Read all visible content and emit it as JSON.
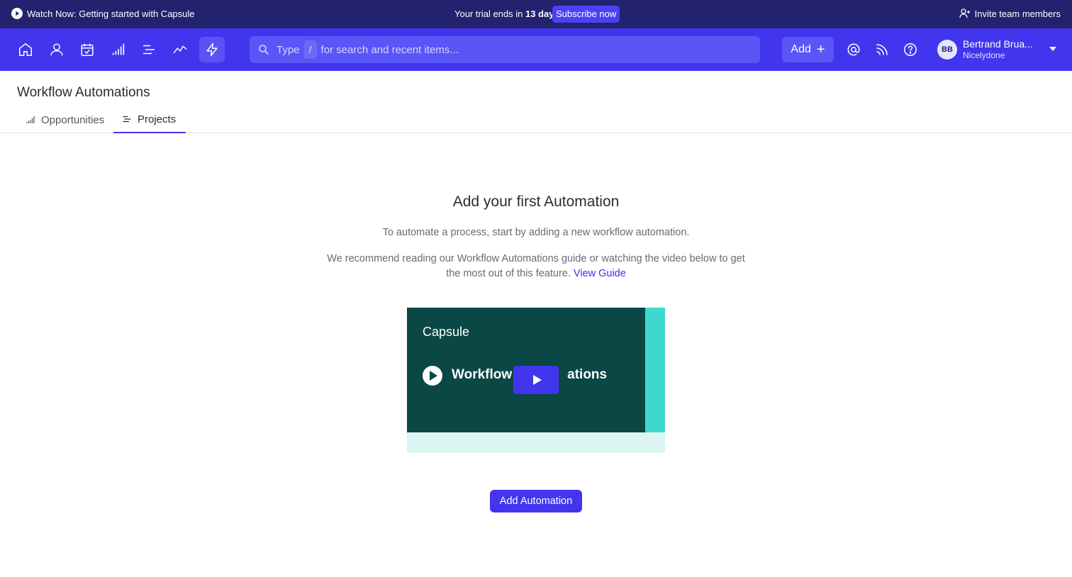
{
  "banner": {
    "watch_label": "Watch Now: Getting started with Capsule",
    "trial_prefix": "Your trial ends in",
    "trial_days": "13 days",
    "subscribe_label": "Subscribe now",
    "invite_label": "Invite team members"
  },
  "nav": {
    "icons": [
      "home-icon",
      "person-icon",
      "calendar-check-icon",
      "bar-chart-icon",
      "list-icon",
      "trend-line-icon",
      "lightning-icon"
    ],
    "active_icon": "lightning-icon",
    "search": {
      "prefix": "Type",
      "key": "/",
      "suffix": "for search and recent items..."
    },
    "add_label": "Add",
    "add_plus": "+",
    "tools": [
      "at-mention-icon",
      "feed-icon",
      "help-icon"
    ],
    "user": {
      "initials": "BB",
      "name": "Bertrand Brua...",
      "org": "Nicelydone"
    }
  },
  "page": {
    "title": "Workflow Automations",
    "tabs": [
      {
        "label": "Opportunities",
        "icon": "bar-chart-icon",
        "active": false
      },
      {
        "label": "Projects",
        "icon": "list-icon",
        "active": true
      }
    ]
  },
  "empty_state": {
    "heading": "Add your first Automation",
    "description": "To automate a process, start by adding a new workflow automation.",
    "recommendation": "We recommend reading our Workflow Automations guide or watching the video below to get the most out of this feature.",
    "guide_link": "View Guide",
    "video": {
      "brand": "Capsule",
      "title_start": "Workflow",
      "title_end": "ations"
    },
    "button_label": "Add Automation"
  },
  "colors": {
    "banner_bg": "#22226e",
    "nav_bg": "#4136ed",
    "accent": "#4136ed",
    "video_bg": "#0b4744",
    "video_stripe": "#3fd8cf"
  }
}
